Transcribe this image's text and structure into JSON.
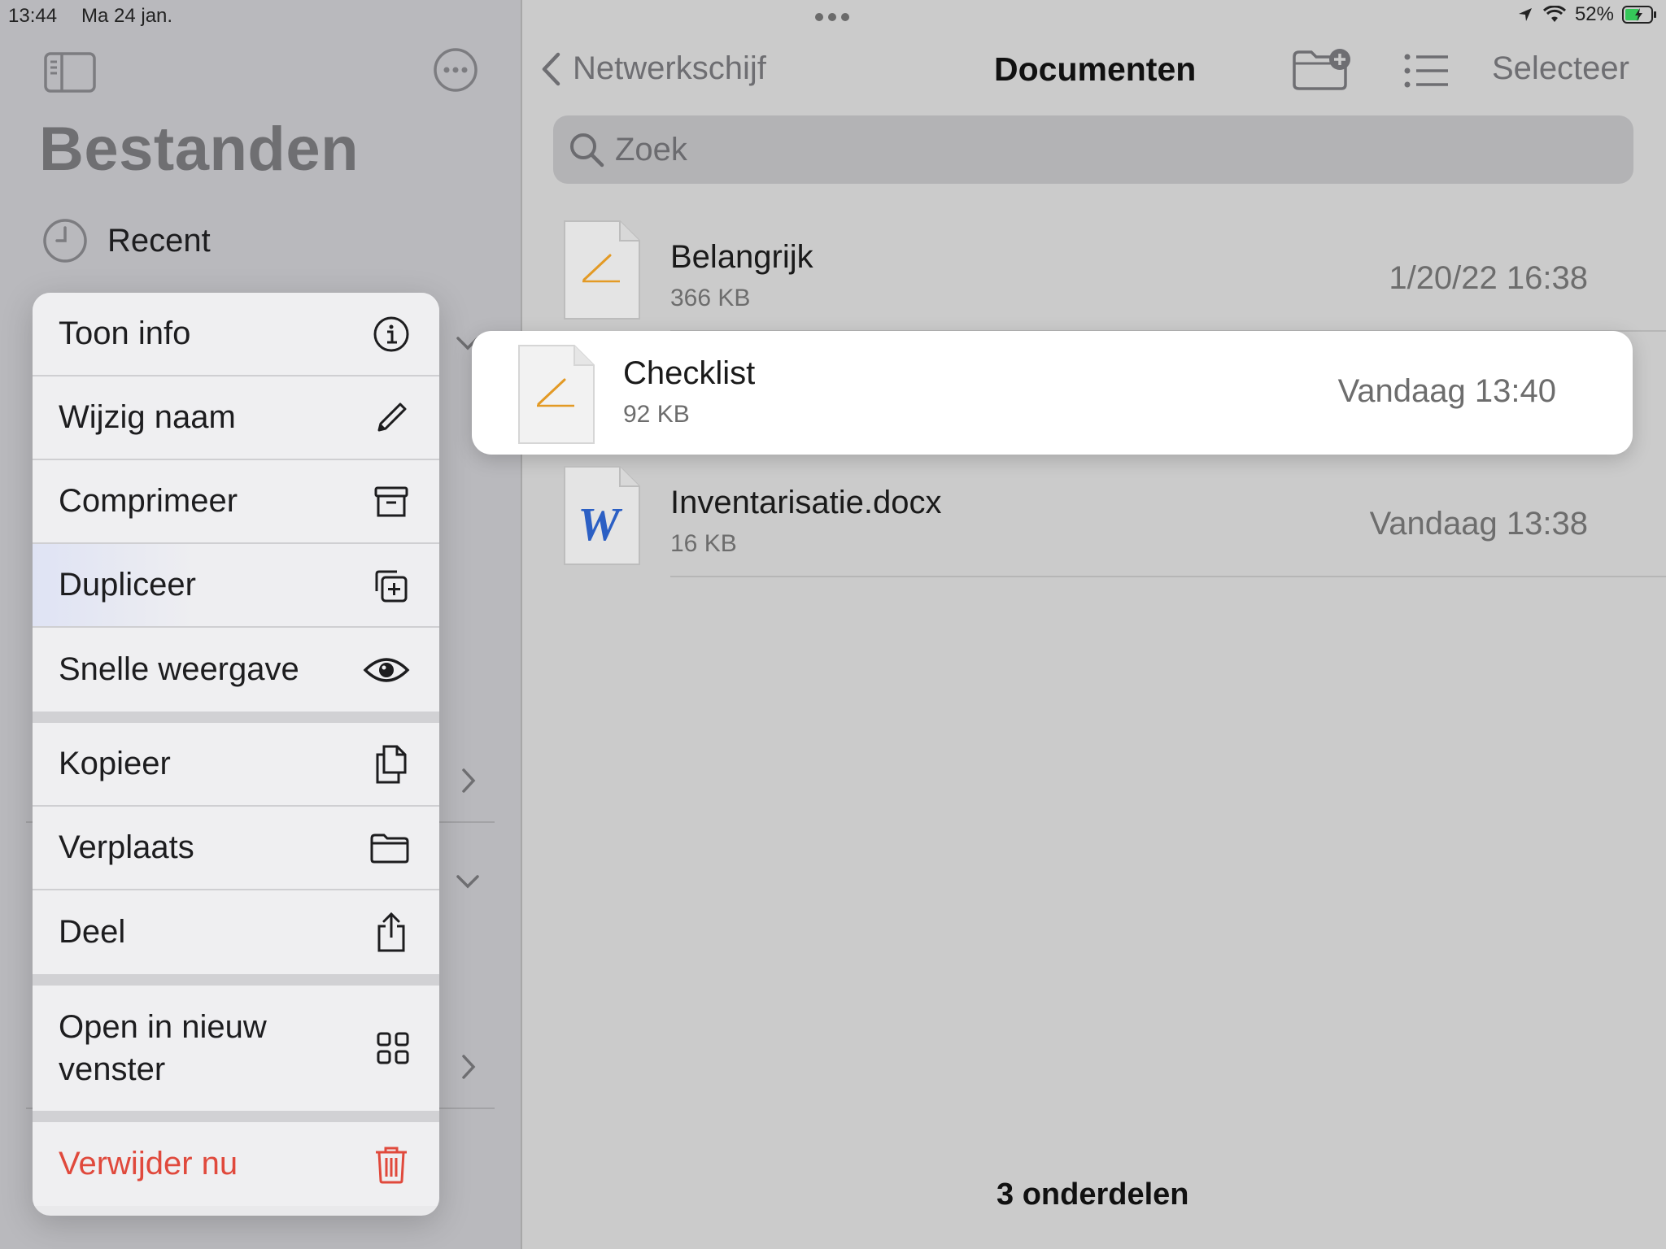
{
  "status_bar": {
    "time": "13:44",
    "date": "Ma 24 jan.",
    "battery": "52%",
    "icons": [
      "location-icon",
      "wifi-icon",
      "battery-icon"
    ]
  },
  "sidebar": {
    "title": "Bestanden",
    "recent_label": "Recent",
    "icons": [
      "sidebar-toggle-icon",
      "more-icon",
      "clock-icon"
    ]
  },
  "context_menu": {
    "items": [
      {
        "label": "Toon info",
        "icon": "info-icon"
      },
      {
        "label": "Wijzig naam",
        "icon": "pencil-icon"
      },
      {
        "label": "Comprimeer",
        "icon": "archive-box-icon"
      },
      {
        "label": "Dupliceer",
        "icon": "duplicate-icon"
      },
      {
        "label": "Snelle weergave",
        "icon": "eye-icon"
      },
      {
        "label": "Kopieer",
        "icon": "copy-icon"
      },
      {
        "label": "Verplaats",
        "icon": "folder-icon"
      },
      {
        "label": "Deel",
        "icon": "share-icon"
      },
      {
        "label": "Open in nieuw venster",
        "icon": "grid-icon"
      },
      {
        "label": "Verwijder nu",
        "icon": "trash-icon",
        "color": "#e0493c"
      }
    ]
  },
  "header": {
    "back_label": "Netwerkschijf",
    "title": "Documenten",
    "select_label": "Selecteer"
  },
  "search": {
    "placeholder": "Zoek"
  },
  "files": [
    {
      "name": "Belangrijk",
      "size": "366 KB",
      "date": "1/20/22 16:38",
      "icon": "pages-doc-icon"
    },
    {
      "name": "Checklist",
      "size": "92 KB",
      "date": "Vandaag 13:40",
      "icon": "pages-doc-icon"
    },
    {
      "name": "Inventarisatie.docx",
      "size": "16 KB",
      "date": "Vandaag 13:38",
      "icon": "word-doc-icon"
    }
  ],
  "footer": {
    "count": "3 onderdelen"
  },
  "colors": {
    "destructive": "#e0493c",
    "accent_text": "#6e6e72"
  }
}
